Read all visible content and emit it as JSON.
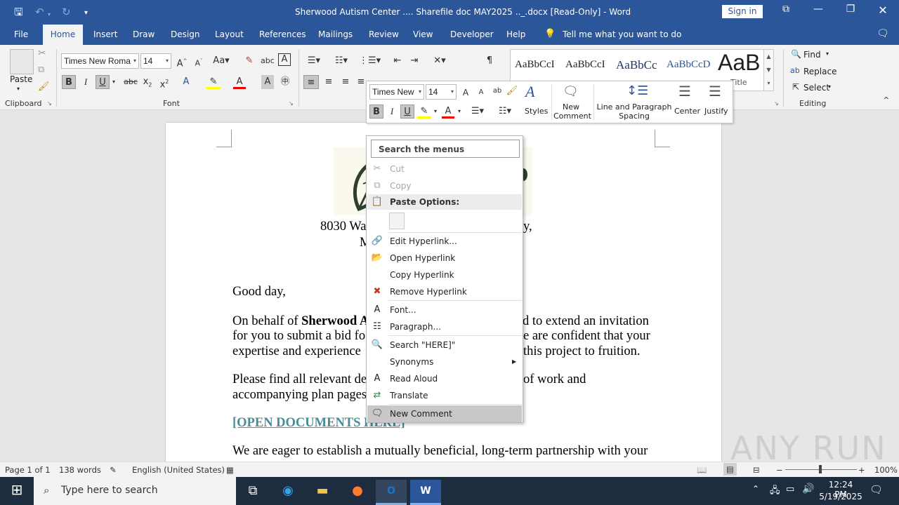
{
  "titlebar": {
    "title": "Sherwood Autism Center .... Sharefile doc MAY2025 .._.docx [Read-Only]  -  Word",
    "signin": "Sign in"
  },
  "tabs": [
    "File",
    "Home",
    "Insert",
    "Draw",
    "Design",
    "Layout",
    "References",
    "Mailings",
    "Review",
    "View",
    "Developer",
    "Help"
  ],
  "tellme": "Tell me what you want to do",
  "ribbon": {
    "clipboard": {
      "paste": "Paste",
      "label": "Clipboard"
    },
    "font": {
      "name": "Times New Roma",
      "size": "14",
      "label": "Font"
    },
    "styles": [
      "AaBbCcI",
      "AaBbCcI",
      "AaBbCc",
      "AaBbCcD",
      "AaB"
    ],
    "style_title": "Title",
    "editing": {
      "find": "Find",
      "replace": "Replace",
      "select": "Select",
      "label": "Editing"
    }
  },
  "minitoolbar": {
    "font": "Times New",
    "size": "14",
    "styles": "Styles",
    "new_comment": "New Comment",
    "line_spacing": "Line and Paragraph Spacing",
    "center": "Center",
    "justify": "Justify"
  },
  "contextmenu": {
    "search_placeholder": "Search the menus",
    "items": {
      "cut": "Cut",
      "copy": "Copy",
      "paste_options": "Paste Options:",
      "edit_hyperlink": "Edit Hyperlink...",
      "open_hyperlink": "Open Hyperlink",
      "copy_hyperlink": "Copy Hyperlink",
      "remove_hyperlink": "Remove Hyperlink",
      "font": "Font...",
      "paragraph": "Paragraph...",
      "search": "Search \"HERE]\"",
      "synonyms": "Synonyms",
      "read_aloud": "Read Aloud",
      "translate": "Translate",
      "new_comment": "New Comment"
    }
  },
  "document": {
    "address1a": "8030 Wa",
    "address1b": "y,",
    "address2": "M",
    "greeting": "Good day,",
    "p1a_pre": "On behalf of ",
    "p1a_bold": "Sherwood A",
    "p1a_post": "d to extend an invitation",
    "p1b_pre": "for you to submit a bid fo",
    "p1b_post": "e are confident that your",
    "p1c_pre": "expertise and experience",
    "p1c_post": "this project to fruition.",
    "p2a_pre": "Please find all relevant de",
    "p2a_post": "of work and",
    "p2b": "accompanying plan pages",
    "link": "[OPEN DOCUMENTS HERE]",
    "p3": "We are eager to establish a mutually beneficial, long-term partnership with your"
  },
  "status": {
    "page": "Page 1 of 1",
    "words": "138 words",
    "language": "English (United States)",
    "zoom": "100%"
  },
  "taskbar": {
    "search": "Type here to search",
    "time": "12:24 PM",
    "date": "5/19/2025"
  },
  "watermark": "ANY RUN"
}
